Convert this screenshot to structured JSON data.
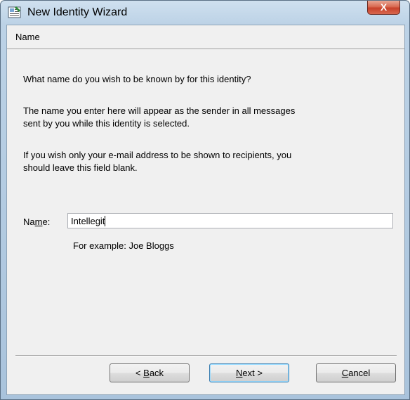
{
  "window": {
    "title": "New Identity Wizard",
    "close_glyph": "X"
  },
  "header": {
    "title": "Name"
  },
  "body": {
    "question": "What name do you wish to be known by for this identity?",
    "para1_line1": "The name you enter here will appear as the sender in all messages",
    "para1_line2": "sent by you while this identity is selected.",
    "para2_line1": "If you wish only your e-mail address to be shown to recipients, you",
    "para2_line2": "should leave this field blank."
  },
  "name_field": {
    "label_pre": "Na",
    "label_mnemonic": "m",
    "label_post": "e:",
    "value": "Intellegit",
    "example": "For example: Joe Bloggs"
  },
  "buttons": {
    "back_pre": "< ",
    "back_mnemonic": "B",
    "back_post": "ack",
    "next_mnemonic": "N",
    "next_post": "ext >",
    "cancel_mnemonic": "C",
    "cancel_post": "ancel"
  },
  "icons": {
    "app": "wizard-identity-icon",
    "close": "close-icon"
  }
}
